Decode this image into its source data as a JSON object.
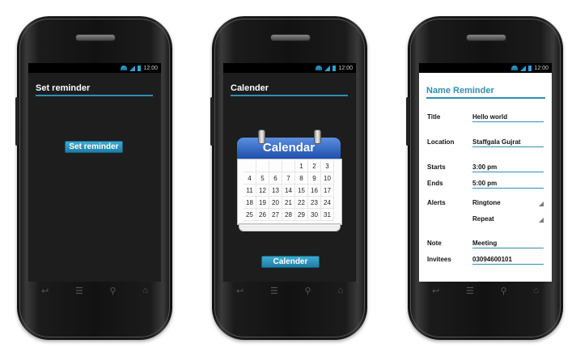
{
  "status": {
    "time": "12:00"
  },
  "nav_icons": [
    "back-icon",
    "menu-icon",
    "search-icon",
    "home-icon"
  ],
  "phone1": {
    "title": "Set reminder",
    "button": "Set reminder"
  },
  "phone2": {
    "title": "Calender",
    "calendar_label": "Calendar",
    "days": [
      "",
      "",
      "",
      "",
      "1",
      "2",
      "3",
      "4",
      "5",
      "6",
      "7",
      "8",
      "9",
      "10",
      "11",
      "12",
      "13",
      "14",
      "15",
      "16",
      "17",
      "18",
      "19",
      "20",
      "21",
      "22",
      "23",
      "24",
      "25",
      "26",
      "27",
      "28",
      "29",
      "30",
      "31"
    ],
    "button": "Calender"
  },
  "phone3": {
    "title": "Name Reminder",
    "fields": {
      "title_label": "Title",
      "title_value": "Hello world",
      "location_label": "Location",
      "location_value": "Staffgala Gujrat",
      "starts_label": "Starts",
      "starts_value": "3:00 pm",
      "ends_label": "Ends",
      "ends_value": "5:00 pm",
      "alerts_label": "Alerts",
      "ringtone_value": "Ringtone",
      "repeat_value": "Repeat",
      "note_label": "Note",
      "note_value": "Meeting",
      "invitees_label": "Invitees",
      "invitees_value": "03094600101"
    }
  }
}
